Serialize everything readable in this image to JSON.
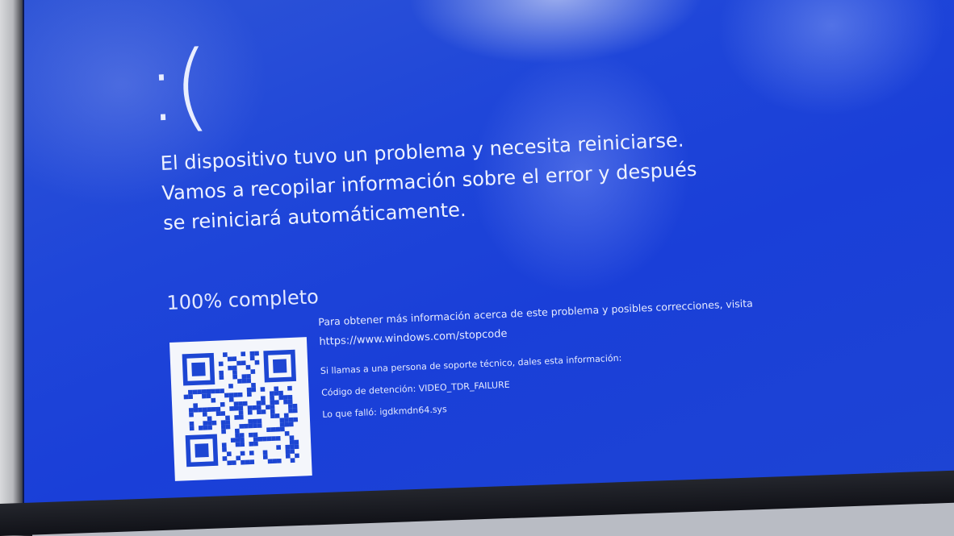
{
  "bsod": {
    "sad_face": ":(",
    "message_lines": [
      "El dispositivo tuvo un problema y necesita reiniciarse.",
      "Vamos a recopilar información sobre el error y después",
      "se reiniciará automáticamente."
    ],
    "progress_text": "100% completo",
    "info_text": "Para obtener más información acerca de este problema y posibles correcciones, visita",
    "url": "https://www.windows.com/stopcode",
    "support_text": "Si llamas a una persona de soporte técnico, dales esta información:",
    "stop_code_line": "Código de detención: VIDEO_TDR_FAILURE",
    "what_failed_line": "Lo que falló: igdkmdn64.sys"
  },
  "colors": {
    "background": "#1f46d9",
    "text": "#eef2ff",
    "qr_dark": "#1d46d3",
    "qr_light": "#f4f6fb"
  },
  "icons": {
    "qr": "qr-code"
  }
}
